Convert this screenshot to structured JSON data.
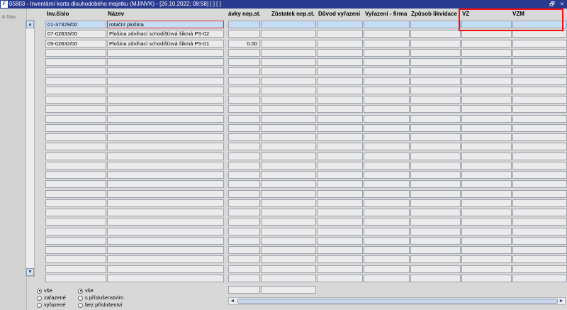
{
  "window": {
    "title": "05803 - Inventární karta dlouhodobého majetku (MJINVK) - [26.10.2022; 08:58]  [ ]  [ ]",
    "app_icon": "F",
    "restore_glyph": "🗗",
    "close_glyph": "×"
  },
  "nav": {
    "label": "Nav"
  },
  "columns": [
    {
      "key": "inv",
      "label": "Inv.číslo"
    },
    {
      "key": "nazev",
      "label": "Název"
    },
    {
      "key": "c3",
      "label": "ávky nep.st."
    },
    {
      "key": "c4",
      "label": "Zůstatek nep.st."
    },
    {
      "key": "c5",
      "label": "Důvod vyřazení"
    },
    {
      "key": "c6",
      "label": "Vyřazení - firma"
    },
    {
      "key": "c7",
      "label": "Způsob likvidace"
    },
    {
      "key": "c8",
      "label": "VZ"
    },
    {
      "key": "c9",
      "label": "VZM"
    }
  ],
  "rows": [
    {
      "inv": "01-37329/00",
      "nazev": "rotační plošina",
      "c3": "",
      "selected": true
    },
    {
      "inv": "07-02833/00",
      "nazev": "Plošina zdvihací schodišťová šikmá PS-02",
      "c3": "",
      "selected": false
    },
    {
      "inv": "09-02832/00",
      "nazev": "Plošina zdvihací schodišťová šikmá PS-01",
      "c3": "0.00",
      "selected": false
    }
  ],
  "filter_left": {
    "options": [
      "vše",
      "zařazené",
      "vyřazené"
    ],
    "selected": 0
  },
  "filter_right": {
    "options": [
      "vše",
      "s příslušenstvím",
      "bez příslušentví"
    ],
    "selected": 0
  },
  "icons": {
    "scroll_up": "▲",
    "scroll_down": "▼",
    "scroll_left": "◄",
    "scroll_right": "►",
    "nav": "⊘"
  }
}
